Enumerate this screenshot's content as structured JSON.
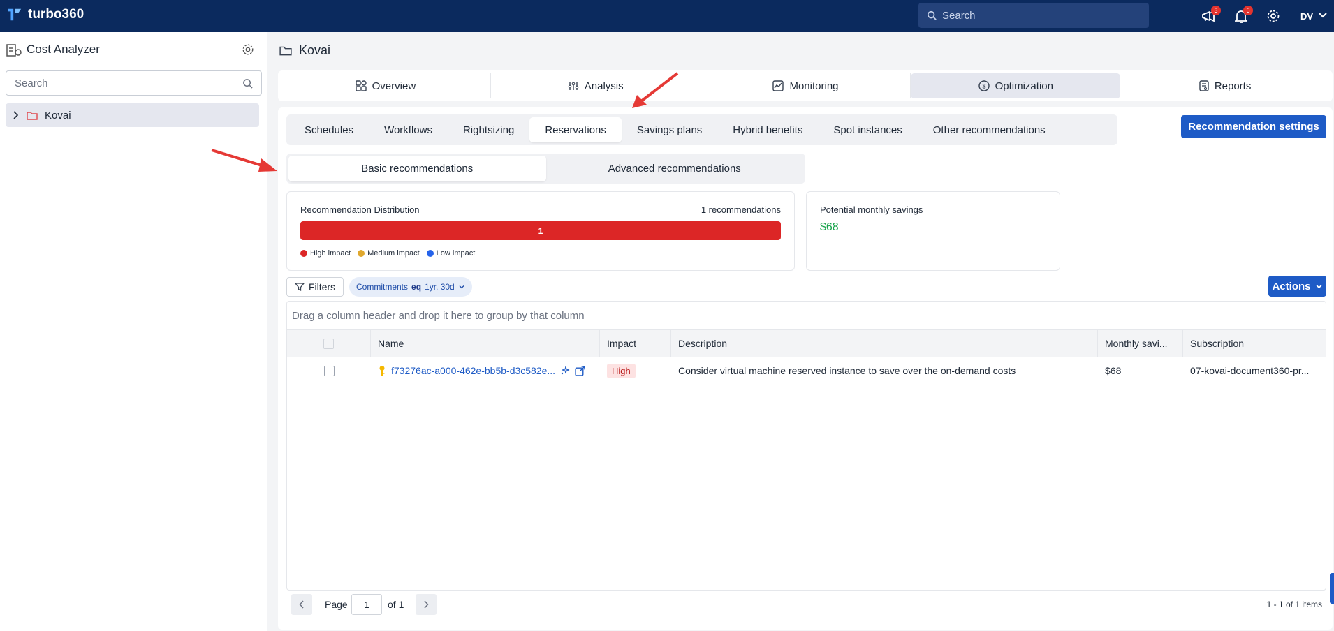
{
  "app": {
    "name": "turbo360"
  },
  "topbar": {
    "search_placeholder": "Search",
    "announcements_count": "3",
    "notifications_count": "6",
    "user_initials": "DV"
  },
  "sidebar": {
    "title": "Cost Analyzer",
    "search_placeholder": "Search",
    "tree_items": [
      {
        "label": "Kovai"
      }
    ]
  },
  "page": {
    "title": "Kovai"
  },
  "main_tabs": [
    {
      "label": "Overview",
      "icon": "overview-icon"
    },
    {
      "label": "Analysis",
      "icon": "analysis-icon"
    },
    {
      "label": "Monitoring",
      "icon": "monitoring-icon"
    },
    {
      "label": "Optimization",
      "icon": "optimization-icon",
      "active": true
    },
    {
      "label": "Reports",
      "icon": "reports-icon"
    }
  ],
  "sub_tabs": [
    {
      "label": "Schedules"
    },
    {
      "label": "Workflows"
    },
    {
      "label": "Rightsizing"
    },
    {
      "label": "Reservations",
      "active": true
    },
    {
      "label": "Savings plans"
    },
    {
      "label": "Hybrid benefits"
    },
    {
      "label": "Spot instances"
    },
    {
      "label": "Other recommendations"
    }
  ],
  "recommendation_settings_label": "Recommendation settings",
  "mode_tabs": [
    {
      "label": "Basic recommendations",
      "active": true
    },
    {
      "label": "Advanced recommendations"
    }
  ],
  "distribution": {
    "label": "Recommendation Distribution",
    "count_label": "1 recommendations",
    "high_count": "1",
    "high_fraction": 1.0,
    "legend": [
      {
        "label": "High impact",
        "color": "#dc2626"
      },
      {
        "label": "Medium impact",
        "color": "#e0a82e"
      },
      {
        "label": "Low impact",
        "color": "#2563eb"
      }
    ]
  },
  "savings": {
    "label": "Potential monthly savings",
    "value": "$68"
  },
  "filters": {
    "button_label": "Filters",
    "chip_field": "Commitments",
    "chip_op": "eq",
    "chip_value": "1yr, 30d"
  },
  "actions_label": "Actions",
  "grid": {
    "group_hint": "Drag a column header and drop it here to group by that column",
    "columns": [
      "Name",
      "Impact",
      "Description",
      "Monthly savi...",
      "Subscription"
    ],
    "rows": [
      {
        "name": "f73276ac-a000-462e-bb5b-d3c582e...",
        "impact": "High",
        "description": "Consider virtual machine reserved instance to save over the on-demand costs",
        "monthly_savings": "$68",
        "subscription": "07-kovai-document360-pr..."
      }
    ]
  },
  "pager": {
    "page_label": "Page",
    "page_value": "1",
    "of_label": "of 1",
    "info": "1 - 1 of 1 items"
  },
  "colors": {
    "topbar": "#0b2a5e",
    "primary": "#1e5bc6",
    "high": "#dc2626",
    "savings": "#16a34a"
  }
}
